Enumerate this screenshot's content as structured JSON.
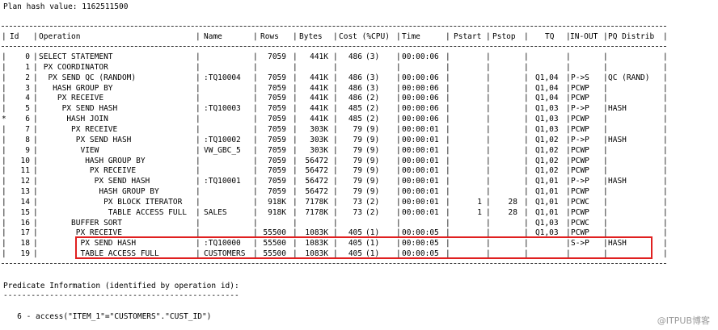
{
  "plan_hash": "Plan hash value: 1162511500",
  "headers": {
    "id": "Id",
    "operation": "Operation",
    "name": "Name",
    "rows": "Rows",
    "bytes": "Bytes",
    "cost": "Cost (%CPU)",
    "time": "Time",
    "pstart": "Pstart",
    "pstop": "Pstop",
    "tq": "TQ",
    "inout": "IN-OUT",
    "pq": "PQ Distrib"
  },
  "rows": [
    {
      "flag": "",
      "id": "0",
      "op": "SELECT STATEMENT",
      "name": "",
      "rows": "7059",
      "bytes": "441K",
      "cost": "486",
      "cpu": "(3)",
      "time": "00:00:06",
      "pstart": "",
      "pstop": "",
      "tq": "",
      "inout": "",
      "pq": ""
    },
    {
      "flag": "",
      "id": "1",
      "op": " PX COORDINATOR",
      "name": "",
      "rows": "",
      "bytes": "",
      "cost": "",
      "cpu": "",
      "time": "",
      "pstart": "",
      "pstop": "",
      "tq": "",
      "inout": "",
      "pq": ""
    },
    {
      "flag": "",
      "id": "2",
      "op": "  PX SEND QC (RANDOM)",
      "name": ":TQ10004",
      "rows": "7059",
      "bytes": "441K",
      "cost": "486",
      "cpu": "(3)",
      "time": "00:00:06",
      "pstart": "",
      "pstop": "",
      "tq": "Q1,04",
      "inout": "P->S",
      "pq": "QC (RAND)"
    },
    {
      "flag": "",
      "id": "3",
      "op": "   HASH GROUP BY",
      "name": "",
      "rows": "7059",
      "bytes": "441K",
      "cost": "486",
      "cpu": "(3)",
      "time": "00:00:06",
      "pstart": "",
      "pstop": "",
      "tq": "Q1,04",
      "inout": "PCWP",
      "pq": ""
    },
    {
      "flag": "",
      "id": "4",
      "op": "    PX RECEIVE",
      "name": "",
      "rows": "7059",
      "bytes": "441K",
      "cost": "486",
      "cpu": "(2)",
      "time": "00:00:06",
      "pstart": "",
      "pstop": "",
      "tq": "Q1,04",
      "inout": "PCWP",
      "pq": ""
    },
    {
      "flag": "",
      "id": "5",
      "op": "     PX SEND HASH",
      "name": ":TQ10003",
      "rows": "7059",
      "bytes": "441K",
      "cost": "485",
      "cpu": "(2)",
      "time": "00:00:06",
      "pstart": "",
      "pstop": "",
      "tq": "Q1,03",
      "inout": "P->P",
      "pq": "HASH"
    },
    {
      "flag": "*",
      "id": "6",
      "op": "      HASH JOIN",
      "name": "",
      "rows": "7059",
      "bytes": "441K",
      "cost": "485",
      "cpu": "(2)",
      "time": "00:00:06",
      "pstart": "",
      "pstop": "",
      "tq": "Q1,03",
      "inout": "PCWP",
      "pq": ""
    },
    {
      "flag": "",
      "id": "7",
      "op": "       PX RECEIVE",
      "name": "",
      "rows": "7059",
      "bytes": "303K",
      "cost": "79",
      "cpu": "(9)",
      "time": "00:00:01",
      "pstart": "",
      "pstop": "",
      "tq": "Q1,03",
      "inout": "PCWP",
      "pq": ""
    },
    {
      "flag": "",
      "id": "8",
      "op": "        PX SEND HASH",
      "name": ":TQ10002",
      "rows": "7059",
      "bytes": "303K",
      "cost": "79",
      "cpu": "(9)",
      "time": "00:00:01",
      "pstart": "",
      "pstop": "",
      "tq": "Q1,02",
      "inout": "P->P",
      "pq": "HASH"
    },
    {
      "flag": "",
      "id": "9",
      "op": "         VIEW",
      "name": "VW_GBC_5",
      "rows": "7059",
      "bytes": "303K",
      "cost": "79",
      "cpu": "(9)",
      "time": "00:00:01",
      "pstart": "",
      "pstop": "",
      "tq": "Q1,02",
      "inout": "PCWP",
      "pq": ""
    },
    {
      "flag": "",
      "id": "10",
      "op": "          HASH GROUP BY",
      "name": "",
      "rows": "7059",
      "bytes": "56472",
      "cost": "79",
      "cpu": "(9)",
      "time": "00:00:01",
      "pstart": "",
      "pstop": "",
      "tq": "Q1,02",
      "inout": "PCWP",
      "pq": ""
    },
    {
      "flag": "",
      "id": "11",
      "op": "           PX RECEIVE",
      "name": "",
      "rows": "7059",
      "bytes": "56472",
      "cost": "79",
      "cpu": "(9)",
      "time": "00:00:01",
      "pstart": "",
      "pstop": "",
      "tq": "Q1,02",
      "inout": "PCWP",
      "pq": ""
    },
    {
      "flag": "",
      "id": "12",
      "op": "            PX SEND HASH",
      "name": ":TQ10001",
      "rows": "7059",
      "bytes": "56472",
      "cost": "79",
      "cpu": "(9)",
      "time": "00:00:01",
      "pstart": "",
      "pstop": "",
      "tq": "Q1,01",
      "inout": "P->P",
      "pq": "HASH"
    },
    {
      "flag": "",
      "id": "13",
      "op": "             HASH GROUP BY",
      "name": "",
      "rows": "7059",
      "bytes": "56472",
      "cost": "79",
      "cpu": "(9)",
      "time": "00:00:01",
      "pstart": "",
      "pstop": "",
      "tq": "Q1,01",
      "inout": "PCWP",
      "pq": ""
    },
    {
      "flag": "",
      "id": "14",
      "op": "              PX BLOCK ITERATOR",
      "name": "",
      "rows": "918K",
      "bytes": "7178K",
      "cost": "73",
      "cpu": "(2)",
      "time": "00:00:01",
      "pstart": "1",
      "pstop": "28",
      "tq": "Q1,01",
      "inout": "PCWC",
      "pq": ""
    },
    {
      "flag": "",
      "id": "15",
      "op": "               TABLE ACCESS FULL",
      "name": "SALES",
      "rows": "918K",
      "bytes": "7178K",
      "cost": "73",
      "cpu": "(2)",
      "time": "00:00:01",
      "pstart": "1",
      "pstop": "28",
      "tq": "Q1,01",
      "inout": "PCWP",
      "pq": ""
    },
    {
      "flag": "",
      "id": "16",
      "op": "       BUFFER SORT",
      "name": "",
      "rows": "",
      "bytes": "",
      "cost": "",
      "cpu": "",
      "time": "",
      "pstart": "",
      "pstop": "",
      "tq": "Q1,03",
      "inout": "PCWC",
      "pq": ""
    },
    {
      "flag": "",
      "id": "17",
      "op": "        PX RECEIVE",
      "name": "",
      "rows": "55500",
      "bytes": "1083K",
      "cost": "405",
      "cpu": "(1)",
      "time": "00:00:05",
      "pstart": "",
      "pstop": "",
      "tq": "Q1,03",
      "inout": "PCWP",
      "pq": ""
    },
    {
      "flag": "",
      "id": "18",
      "op": "         PX SEND HASH",
      "name": ":TQ10000",
      "rows": "55500",
      "bytes": "1083K",
      "cost": "405",
      "cpu": "(1)",
      "time": "00:00:05",
      "pstart": "",
      "pstop": "",
      "tq": "",
      "inout": "S->P",
      "pq": "HASH"
    },
    {
      "flag": "",
      "id": "19",
      "op": "         TABLE ACCESS FULL",
      "name": "CUSTOMERS",
      "rows": "55500",
      "bytes": "1083K",
      "cost": "405",
      "cpu": "(1)",
      "time": "00:00:05",
      "pstart": "",
      "pstop": "",
      "tq": "",
      "inout": "",
      "pq": ""
    }
  ],
  "predicate_title": "Predicate Information (identified by operation id):",
  "predicate_rule": "---------------------------------------------------",
  "predicate_line": "   6 - access(\"ITEM_1\"=\"CUSTOMERS\".\"CUST_ID\")",
  "watermark": "@ITPUB博客",
  "colors": {
    "highlight": "#e02020"
  }
}
